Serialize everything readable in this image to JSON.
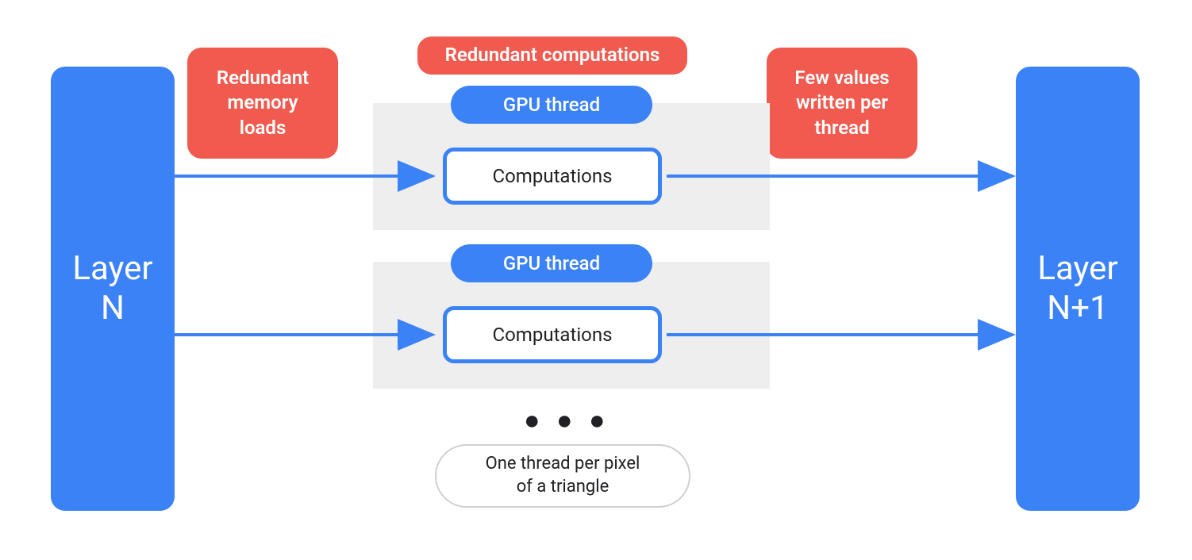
{
  "colors": {
    "blue": "#3b82f6",
    "red": "#f05a4f",
    "gray_bg": "#eeeeee",
    "text_dark": "#202124"
  },
  "layer_left": {
    "label": "Layer\nN"
  },
  "layer_right": {
    "label": "Layer\nN+1"
  },
  "callouts": {
    "redundant_memory": "Redundant\nmemory\nloads",
    "redundant_computations": "Redundant computations",
    "few_values": "Few values\nwritten per\nthread"
  },
  "threads": [
    {
      "pill": "GPU thread",
      "box": "Computations"
    },
    {
      "pill": "GPU thread",
      "box": "Computations"
    }
  ],
  "ellipsis": "● ● ●",
  "footnote": "One thread per pixel\nof a triangle"
}
